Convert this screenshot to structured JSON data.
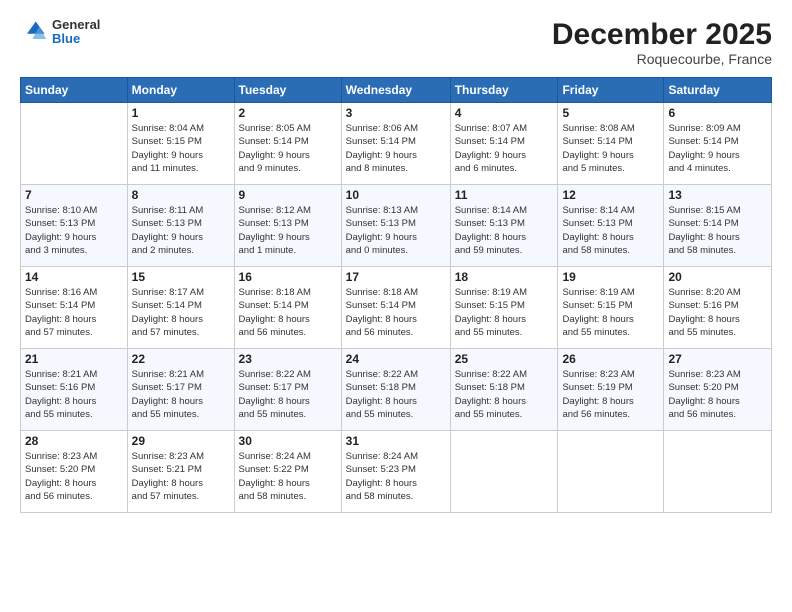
{
  "header": {
    "logo": {
      "general": "General",
      "blue": "Blue"
    },
    "title": "December 2025",
    "location": "Roquecourbe, France"
  },
  "calendar": {
    "weekdays": [
      "Sunday",
      "Monday",
      "Tuesday",
      "Wednesday",
      "Thursday",
      "Friday",
      "Saturday"
    ],
    "weeks": [
      [
        {
          "day": "",
          "info": ""
        },
        {
          "day": "1",
          "info": "Sunrise: 8:04 AM\nSunset: 5:15 PM\nDaylight: 9 hours\nand 11 minutes."
        },
        {
          "day": "2",
          "info": "Sunrise: 8:05 AM\nSunset: 5:14 PM\nDaylight: 9 hours\nand 9 minutes."
        },
        {
          "day": "3",
          "info": "Sunrise: 8:06 AM\nSunset: 5:14 PM\nDaylight: 9 hours\nand 8 minutes."
        },
        {
          "day": "4",
          "info": "Sunrise: 8:07 AM\nSunset: 5:14 PM\nDaylight: 9 hours\nand 6 minutes."
        },
        {
          "day": "5",
          "info": "Sunrise: 8:08 AM\nSunset: 5:14 PM\nDaylight: 9 hours\nand 5 minutes."
        },
        {
          "day": "6",
          "info": "Sunrise: 8:09 AM\nSunset: 5:14 PM\nDaylight: 9 hours\nand 4 minutes."
        }
      ],
      [
        {
          "day": "7",
          "info": "Sunrise: 8:10 AM\nSunset: 5:13 PM\nDaylight: 9 hours\nand 3 minutes."
        },
        {
          "day": "8",
          "info": "Sunrise: 8:11 AM\nSunset: 5:13 PM\nDaylight: 9 hours\nand 2 minutes."
        },
        {
          "day": "9",
          "info": "Sunrise: 8:12 AM\nSunset: 5:13 PM\nDaylight: 9 hours\nand 1 minute."
        },
        {
          "day": "10",
          "info": "Sunrise: 8:13 AM\nSunset: 5:13 PM\nDaylight: 9 hours\nand 0 minutes."
        },
        {
          "day": "11",
          "info": "Sunrise: 8:14 AM\nSunset: 5:13 PM\nDaylight: 8 hours\nand 59 minutes."
        },
        {
          "day": "12",
          "info": "Sunrise: 8:14 AM\nSunset: 5:13 PM\nDaylight: 8 hours\nand 58 minutes."
        },
        {
          "day": "13",
          "info": "Sunrise: 8:15 AM\nSunset: 5:14 PM\nDaylight: 8 hours\nand 58 minutes."
        }
      ],
      [
        {
          "day": "14",
          "info": "Sunrise: 8:16 AM\nSunset: 5:14 PM\nDaylight: 8 hours\nand 57 minutes."
        },
        {
          "day": "15",
          "info": "Sunrise: 8:17 AM\nSunset: 5:14 PM\nDaylight: 8 hours\nand 57 minutes."
        },
        {
          "day": "16",
          "info": "Sunrise: 8:18 AM\nSunset: 5:14 PM\nDaylight: 8 hours\nand 56 minutes."
        },
        {
          "day": "17",
          "info": "Sunrise: 8:18 AM\nSunset: 5:14 PM\nDaylight: 8 hours\nand 56 minutes."
        },
        {
          "day": "18",
          "info": "Sunrise: 8:19 AM\nSunset: 5:15 PM\nDaylight: 8 hours\nand 55 minutes."
        },
        {
          "day": "19",
          "info": "Sunrise: 8:19 AM\nSunset: 5:15 PM\nDaylight: 8 hours\nand 55 minutes."
        },
        {
          "day": "20",
          "info": "Sunrise: 8:20 AM\nSunset: 5:16 PM\nDaylight: 8 hours\nand 55 minutes."
        }
      ],
      [
        {
          "day": "21",
          "info": "Sunrise: 8:21 AM\nSunset: 5:16 PM\nDaylight: 8 hours\nand 55 minutes."
        },
        {
          "day": "22",
          "info": "Sunrise: 8:21 AM\nSunset: 5:17 PM\nDaylight: 8 hours\nand 55 minutes."
        },
        {
          "day": "23",
          "info": "Sunrise: 8:22 AM\nSunset: 5:17 PM\nDaylight: 8 hours\nand 55 minutes."
        },
        {
          "day": "24",
          "info": "Sunrise: 8:22 AM\nSunset: 5:18 PM\nDaylight: 8 hours\nand 55 minutes."
        },
        {
          "day": "25",
          "info": "Sunrise: 8:22 AM\nSunset: 5:18 PM\nDaylight: 8 hours\nand 55 minutes."
        },
        {
          "day": "26",
          "info": "Sunrise: 8:23 AM\nSunset: 5:19 PM\nDaylight: 8 hours\nand 56 minutes."
        },
        {
          "day": "27",
          "info": "Sunrise: 8:23 AM\nSunset: 5:20 PM\nDaylight: 8 hours\nand 56 minutes."
        }
      ],
      [
        {
          "day": "28",
          "info": "Sunrise: 8:23 AM\nSunset: 5:20 PM\nDaylight: 8 hours\nand 56 minutes."
        },
        {
          "day": "29",
          "info": "Sunrise: 8:23 AM\nSunset: 5:21 PM\nDaylight: 8 hours\nand 57 minutes."
        },
        {
          "day": "30",
          "info": "Sunrise: 8:24 AM\nSunset: 5:22 PM\nDaylight: 8 hours\nand 58 minutes."
        },
        {
          "day": "31",
          "info": "Sunrise: 8:24 AM\nSunset: 5:23 PM\nDaylight: 8 hours\nand 58 minutes."
        },
        {
          "day": "",
          "info": ""
        },
        {
          "day": "",
          "info": ""
        },
        {
          "day": "",
          "info": ""
        }
      ]
    ]
  }
}
